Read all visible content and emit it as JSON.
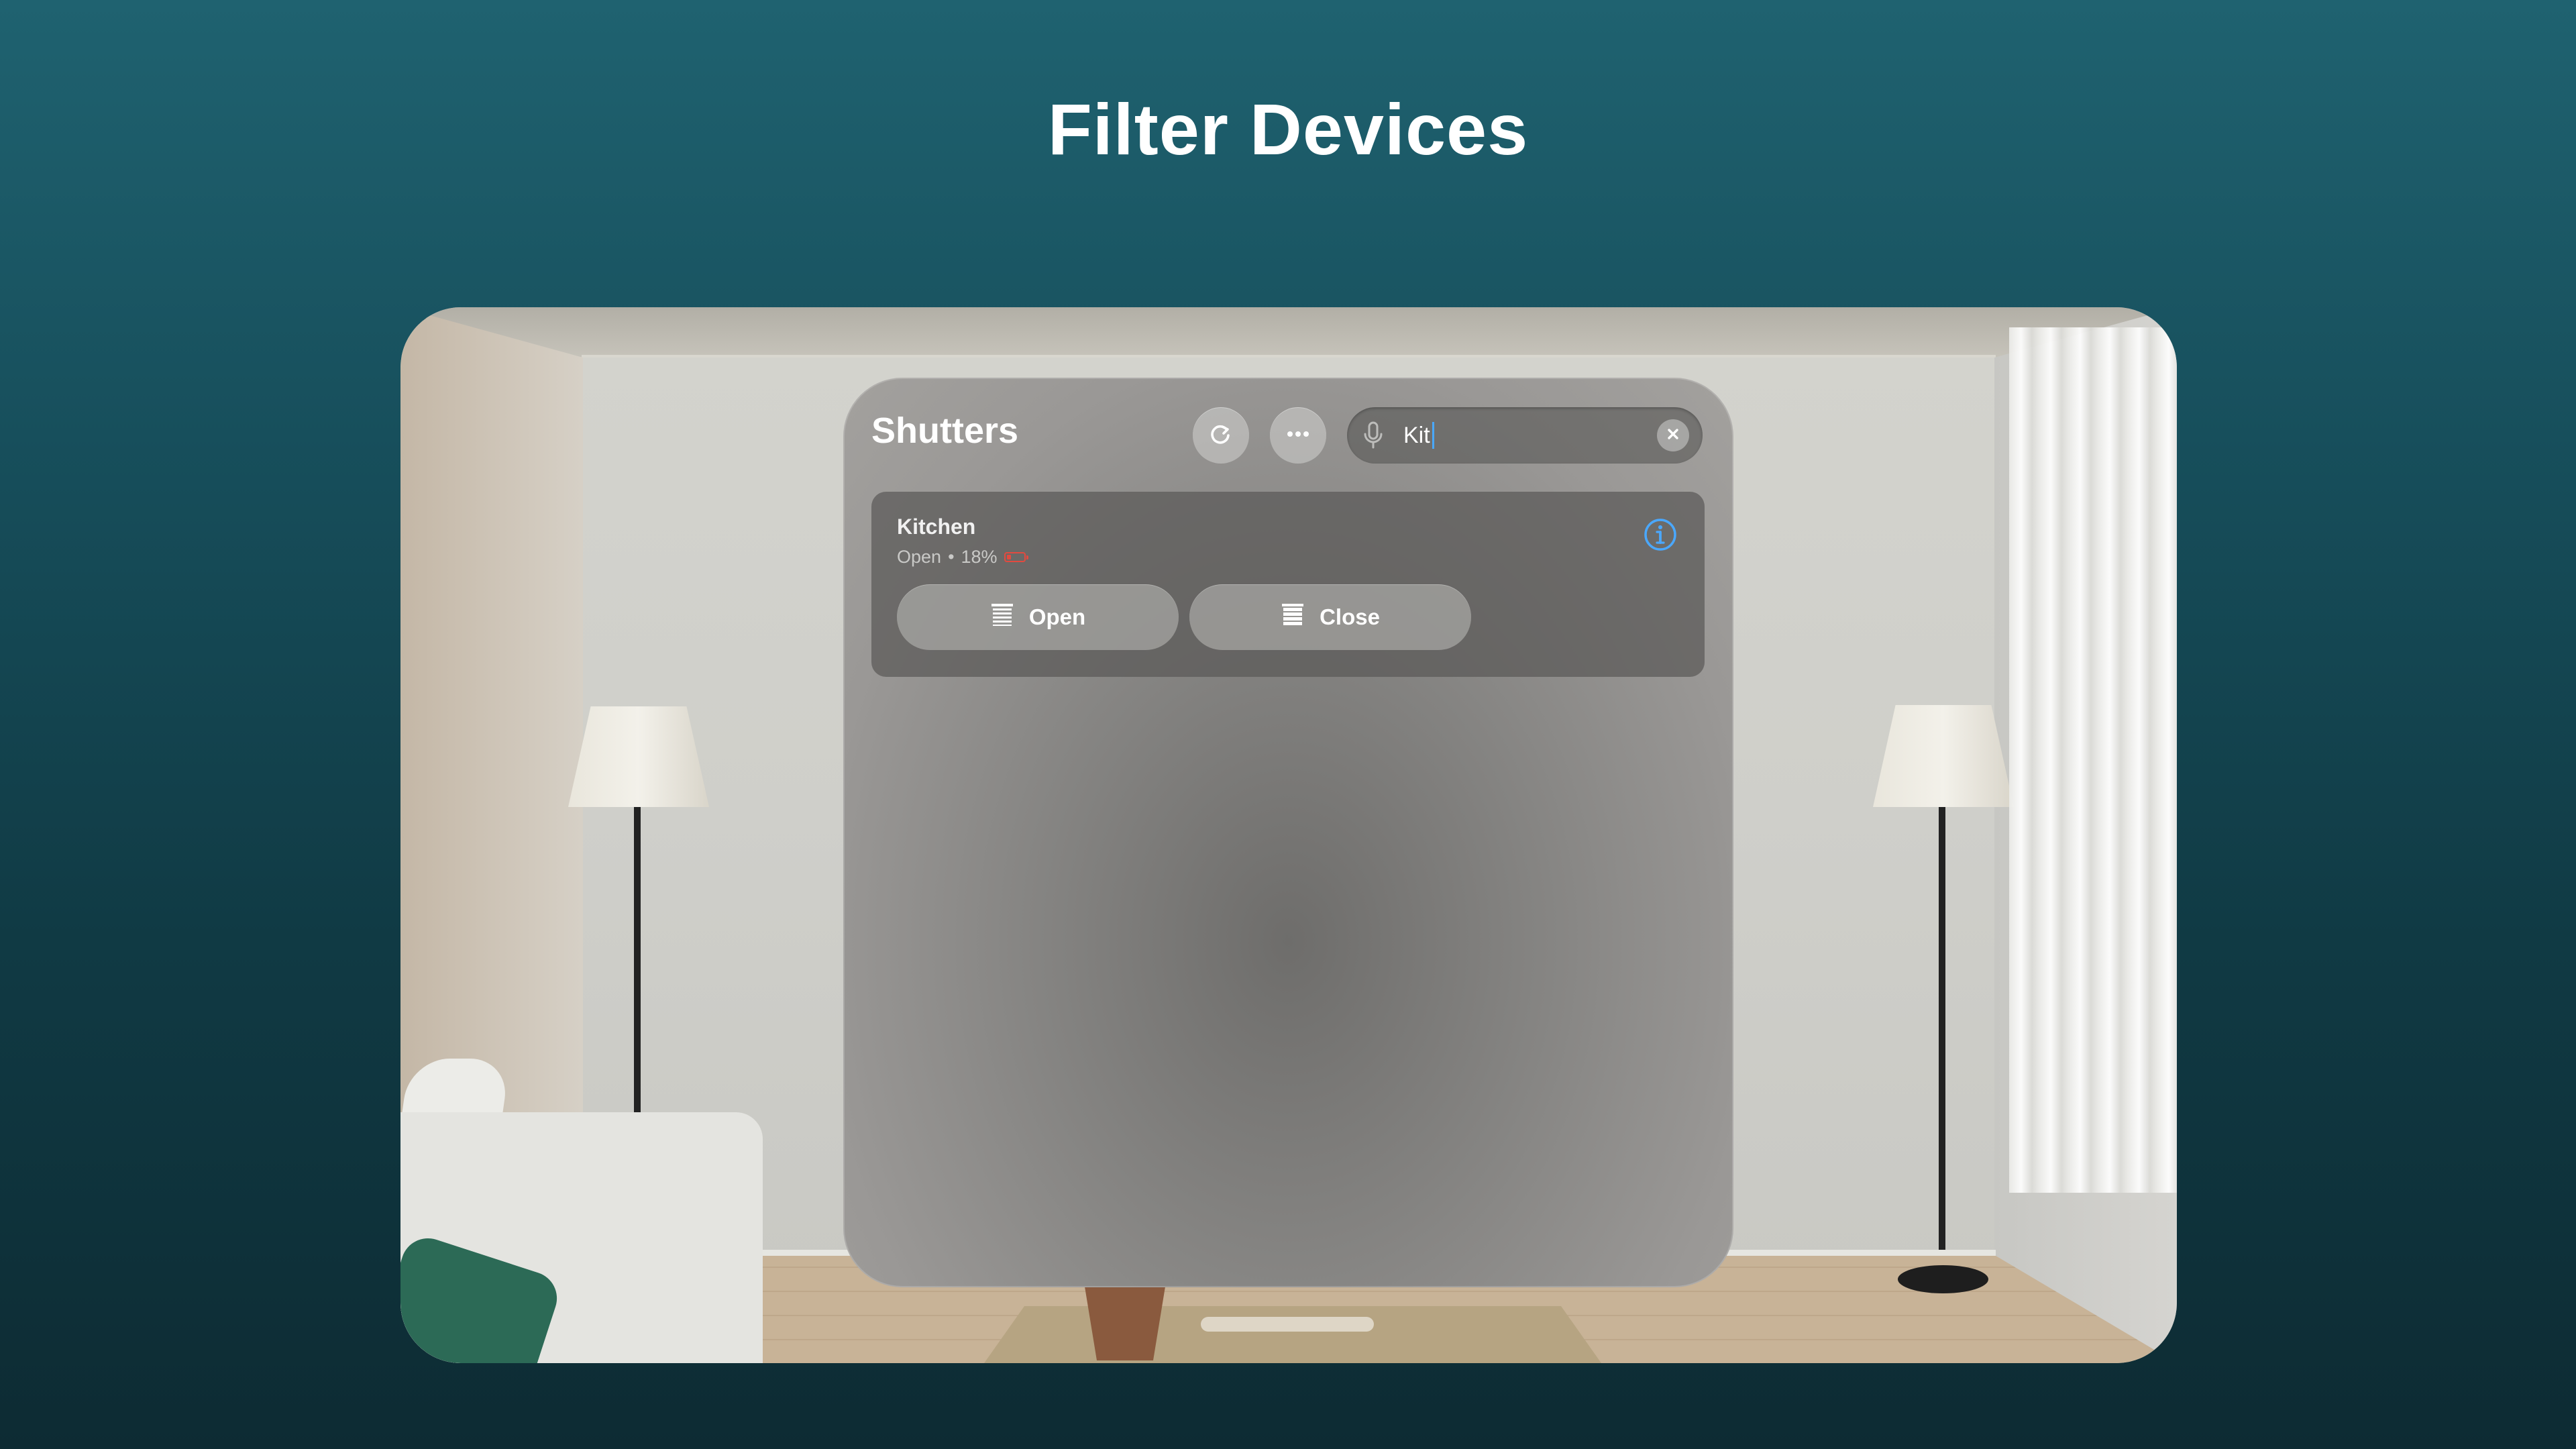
{
  "headline": "Filter Devices",
  "window": {
    "title": "Shutters",
    "refresh_icon": "arrow-clockwise-icon",
    "more_icon": "ellipsis-icon",
    "search": {
      "value": "Kit",
      "mic_icon": "microphone-icon",
      "clear_icon": "xmark-icon"
    },
    "devices": [
      {
        "name": "Kitchen",
        "state": "Open",
        "separator": "•",
        "battery": "18%",
        "battery_color": "#e34a3f",
        "info_icon": "info-circle-icon",
        "info_color": "#4aa8ff",
        "actions": [
          {
            "label": "Open",
            "icon": "blinds-icon"
          },
          {
            "label": "Close",
            "icon": "blinds-closed-icon"
          }
        ]
      }
    ]
  }
}
